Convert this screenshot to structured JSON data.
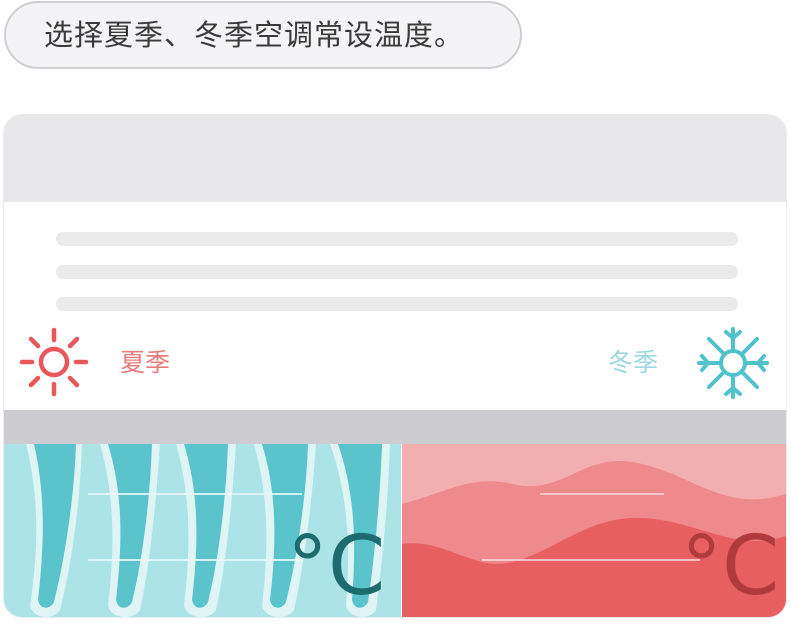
{
  "instruction": {
    "text": "选择夏季、冬季空调常设温度。"
  },
  "seasons": {
    "summer": {
      "label": "夏季",
      "icon": "sun-icon",
      "color": "#e8585a"
    },
    "winter": {
      "label": "冬季",
      "icon": "snowflake-icon",
      "color": "#4fc2cb"
    }
  },
  "panels": {
    "winter": {
      "unit": "°C",
      "background": "#ace3e6",
      "accent": "#5bc3cc"
    },
    "summer": {
      "unit": "°C",
      "background": "#f3aeb0",
      "accent": "#e76062"
    }
  }
}
